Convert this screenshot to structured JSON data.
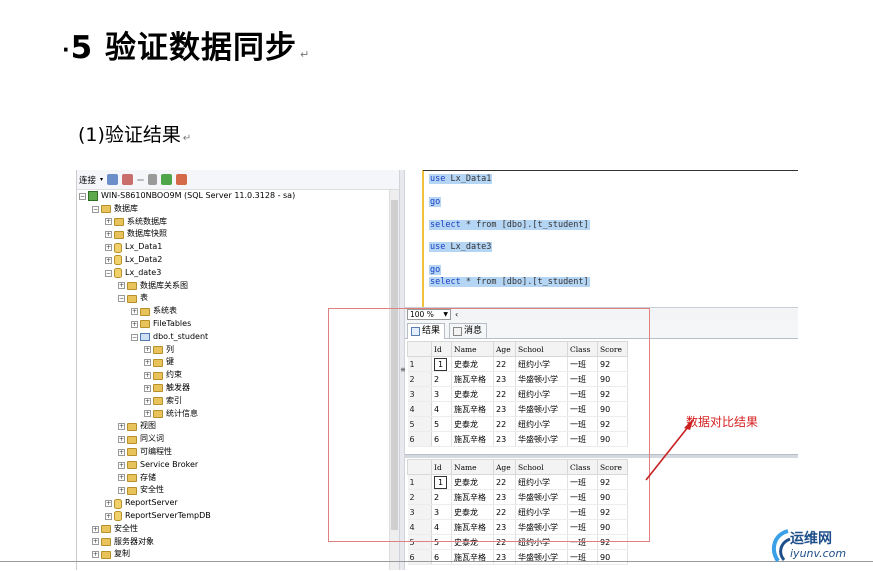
{
  "slide": {
    "title_bullet": "·",
    "title": "5 验证数据同步",
    "subtitle": "(1)验证结果",
    "para_mark": "↵"
  },
  "object_explorer": {
    "toolbar_label": "连接",
    "tree": [
      {
        "label": "WIN-S8610NBOO9M (SQL Server 11.0.3128 - sa)",
        "level": 0,
        "expander": "−",
        "icon": "server-icon"
      },
      {
        "label": "数据库",
        "level": 1,
        "expander": "−",
        "icon": "folder-icon"
      },
      {
        "label": "系统数据库",
        "level": 2,
        "expander": "+",
        "icon": "folder-icon"
      },
      {
        "label": "数据库快照",
        "level": 2,
        "expander": "+",
        "icon": "folder-icon"
      },
      {
        "label": "Lx_Data1",
        "level": 2,
        "expander": "+",
        "icon": "database-icon"
      },
      {
        "label": "Lx_Data2",
        "level": 2,
        "expander": "+",
        "icon": "database-icon"
      },
      {
        "label": "Lx_date3",
        "level": 2,
        "expander": "−",
        "icon": "database-icon"
      },
      {
        "label": "数据库关系图",
        "level": 3,
        "expander": "+",
        "icon": "folder-icon"
      },
      {
        "label": "表",
        "level": 3,
        "expander": "−",
        "icon": "folder-icon"
      },
      {
        "label": "系统表",
        "level": 4,
        "expander": "+",
        "icon": "folder-icon"
      },
      {
        "label": "FileTables",
        "level": 4,
        "expander": "+",
        "icon": "folder-icon"
      },
      {
        "label": "dbo.t_student",
        "level": 4,
        "expander": "−",
        "icon": "table-icon"
      },
      {
        "label": "列",
        "level": 5,
        "expander": "+",
        "icon": "folder-icon"
      },
      {
        "label": "键",
        "level": 5,
        "expander": "+",
        "icon": "folder-icon"
      },
      {
        "label": "约束",
        "level": 5,
        "expander": "+",
        "icon": "folder-icon"
      },
      {
        "label": "触发器",
        "level": 5,
        "expander": "+",
        "icon": "folder-icon"
      },
      {
        "label": "索引",
        "level": 5,
        "expander": "+",
        "icon": "folder-icon"
      },
      {
        "label": "统计信息",
        "level": 5,
        "expander": "+",
        "icon": "folder-icon"
      },
      {
        "label": "视图",
        "level": 3,
        "expander": "+",
        "icon": "folder-icon"
      },
      {
        "label": "同义词",
        "level": 3,
        "expander": "+",
        "icon": "folder-icon"
      },
      {
        "label": "可编程性",
        "level": 3,
        "expander": "+",
        "icon": "folder-icon"
      },
      {
        "label": "Service Broker",
        "level": 3,
        "expander": "+",
        "icon": "folder-icon"
      },
      {
        "label": "存储",
        "level": 3,
        "expander": "+",
        "icon": "folder-icon"
      },
      {
        "label": "安全性",
        "level": 3,
        "expander": "+",
        "icon": "folder-icon"
      },
      {
        "label": "ReportServer",
        "level": 2,
        "expander": "+",
        "icon": "database-icon"
      },
      {
        "label": "ReportServerTempDB",
        "level": 2,
        "expander": "+",
        "icon": "database-icon"
      },
      {
        "label": "安全性",
        "level": 1,
        "expander": "+",
        "icon": "folder-icon"
      },
      {
        "label": "服务器对象",
        "level": 1,
        "expander": "+",
        "icon": "folder-icon"
      },
      {
        "label": "复制",
        "level": 1,
        "expander": "+",
        "icon": "folder-icon"
      }
    ]
  },
  "editor": {
    "lines": [
      {
        "kw": "use",
        "rest": " Lx_Data1"
      },
      {
        "kw": "go",
        "rest": ""
      },
      {
        "kw": "select",
        "rest": " * from  [dbo].[t_student]"
      },
      {
        "kw": "use",
        "rest": " Lx_date3"
      },
      {
        "kw": "go",
        "rest": ""
      },
      {
        "kw": "select",
        "rest": " * from  [dbo].[t_student]"
      }
    ]
  },
  "zoom": {
    "value": "100 %"
  },
  "results": {
    "tab_results": "结果",
    "tab_messages": "消息",
    "columns": [
      "Id",
      "Name",
      "Age",
      "School",
      "Class",
      "Score"
    ],
    "grid1": [
      [
        "1",
        "1",
        "史泰龙",
        "22",
        "纽约小学",
        "一班",
        "92"
      ],
      [
        "2",
        "2",
        "施瓦辛格",
        "23",
        "华盛顿小学",
        "一班",
        "90"
      ],
      [
        "3",
        "3",
        "史泰龙",
        "22",
        "纽约小学",
        "一班",
        "92"
      ],
      [
        "4",
        "4",
        "施瓦辛格",
        "23",
        "华盛顿小学",
        "一班",
        "90"
      ],
      [
        "5",
        "5",
        "史泰龙",
        "22",
        "纽约小学",
        "一班",
        "92"
      ],
      [
        "6",
        "6",
        "施瓦辛格",
        "23",
        "华盛顿小学",
        "一班",
        "90"
      ]
    ],
    "grid2": [
      [
        "1",
        "1",
        "史泰龙",
        "22",
        "纽约小学",
        "一班",
        "92"
      ],
      [
        "2",
        "2",
        "施瓦辛格",
        "23",
        "华盛顿小学",
        "一班",
        "90"
      ],
      [
        "3",
        "3",
        "史泰龙",
        "22",
        "纽约小学",
        "一班",
        "92"
      ],
      [
        "4",
        "4",
        "施瓦辛格",
        "23",
        "华盛顿小学",
        "一班",
        "90"
      ],
      [
        "5",
        "5",
        "史泰龙",
        "22",
        "纽约小学",
        "一班",
        "92"
      ],
      [
        "6",
        "6",
        "施瓦辛格",
        "23",
        "华盛顿小学",
        "一班",
        "90"
      ]
    ]
  },
  "annotation": {
    "text": "数据对比结果",
    "color": "#d42020"
  },
  "watermark": {
    "line1": "运维网",
    "line2": "iyunv.com"
  }
}
